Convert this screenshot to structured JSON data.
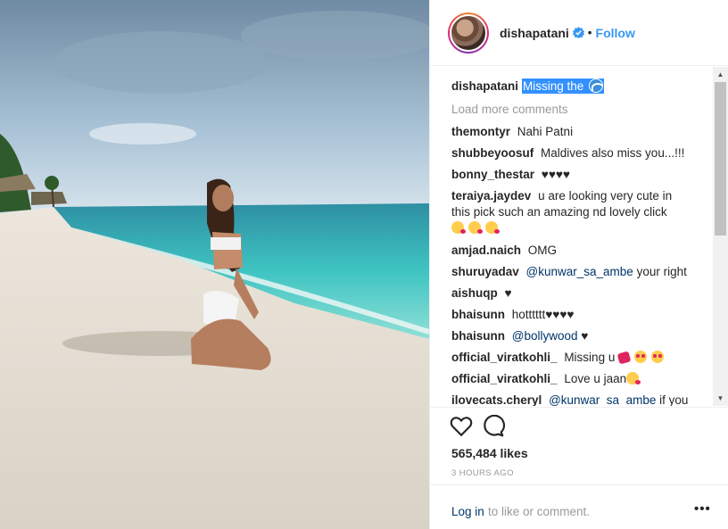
{
  "header": {
    "username": "dishapatani",
    "separator": "•",
    "follow_label": "Follow"
  },
  "caption": {
    "username": "dishapatani",
    "text": "Missing the"
  },
  "load_more_label": "Load more comments",
  "comments": [
    {
      "user": "themontyr",
      "text": "Nahi Patni"
    },
    {
      "user": "shubbeyoosuf",
      "text": "Maldives also miss you...!!!"
    },
    {
      "user": "bonny_thestar",
      "text": "♥♥♥♥"
    },
    {
      "user": "teraiya.jaydev",
      "text": "u are looking very cute in this pick such an amazing nd lovely click"
    },
    {
      "user": "amjad.naich",
      "text": "OMG"
    },
    {
      "user": "shuruyadav",
      "mention": "@kunwar_sa_ambe",
      "text": "your right"
    },
    {
      "user": "aishuqp",
      "text": "♥"
    },
    {
      "user": "bhaisunn",
      "text": "hotttttt♥♥♥♥"
    },
    {
      "user": "bhaisunn",
      "mention": "@bollywood",
      "text": "♥"
    },
    {
      "user": "official_viratkohli_",
      "text": "Missing u"
    },
    {
      "user": "official_viratkohli_",
      "text": "Love u jaan"
    },
    {
      "user": "ilovecats.cheryl",
      "mention": "@kunwar_sa_ambe",
      "text": "if you"
    }
  ],
  "likes": "565,484 likes",
  "timestamp": "3 HOURS AGO",
  "footer": {
    "login_label": "Log in",
    "rest_text": "to like or comment.",
    "more_label": "•••"
  },
  "icons": {
    "like": "heart-icon",
    "comment": "comment-icon",
    "verified": "verified-badge-icon",
    "more": "more-options-icon"
  },
  "colors": {
    "link_blue": "#3897f0",
    "caption_highlight": "#3390ff",
    "muted_text": "#999999"
  }
}
